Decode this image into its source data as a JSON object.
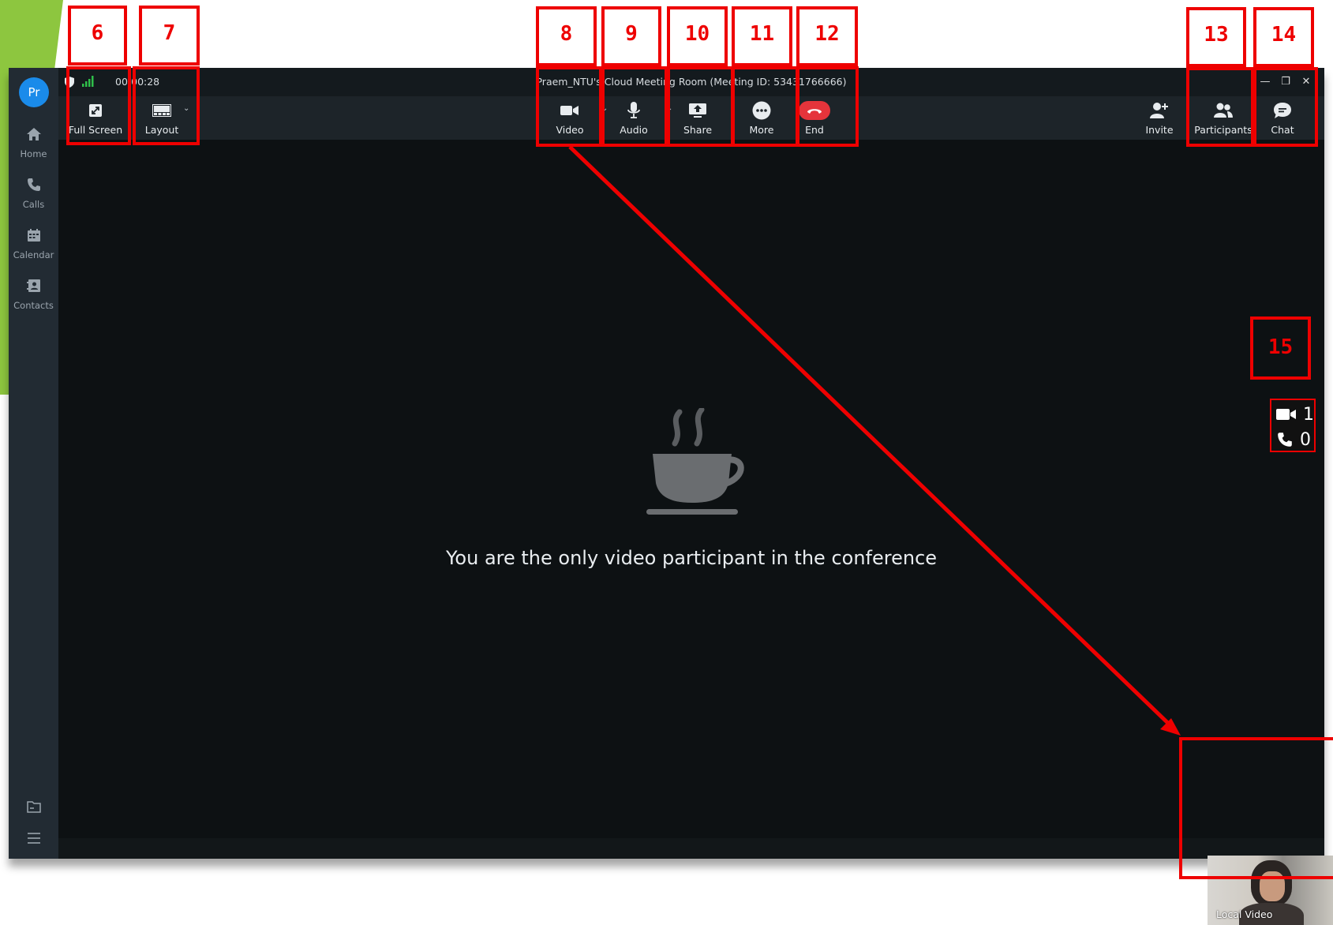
{
  "sidebar": {
    "avatar": "Pr",
    "items": [
      {
        "label": "Home",
        "icon": "home-icon"
      },
      {
        "label": "Calls",
        "icon": "phone-icon"
      },
      {
        "label": "Calendar",
        "icon": "calendar-icon"
      },
      {
        "label": "Contacts",
        "icon": "contacts-icon"
      }
    ],
    "bottom_icons": [
      "folder-icon",
      "menu-icon"
    ]
  },
  "titlebar": {
    "timer": "00:00:28",
    "title": "Praem_NTU's Cloud Meeting Room  (Meeting ID: 53431766666)"
  },
  "toolbar": {
    "fullscreen": "Full Screen",
    "layout": "Layout",
    "video": "Video",
    "audio": "Audio",
    "share": "Share",
    "more": "More",
    "end": "End",
    "invite": "Invite",
    "participants": "Participants",
    "chat": "Chat"
  },
  "stage": {
    "message": "You are the only video participant in the conference"
  },
  "counter": {
    "video_count": "1",
    "phone_count": "0"
  },
  "local_video": {
    "label": "Local Video"
  },
  "annotations": [
    "6",
    "7",
    "8",
    "9",
    "10",
    "11",
    "12",
    "13",
    "14",
    "15"
  ],
  "colors": {
    "accent_green": "#8dc63f",
    "annotation_red": "#ee0000",
    "end_red": "#e5343b",
    "avatar_blue": "#1a8bea"
  }
}
